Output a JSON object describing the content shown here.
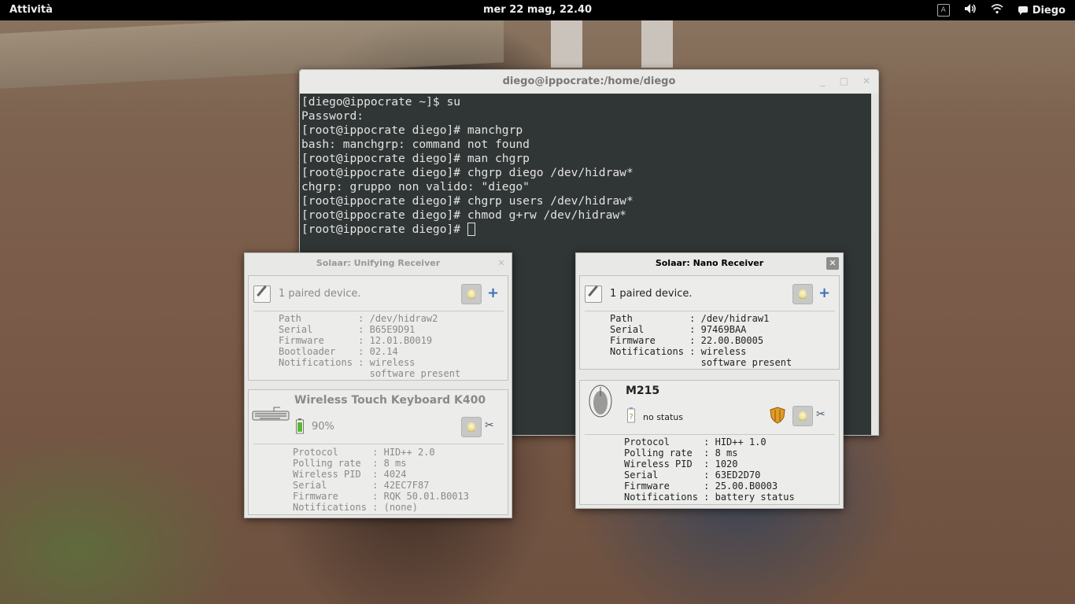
{
  "topbar": {
    "activities": "Attività",
    "clock": "mer 22 mag, 22.40",
    "user": "Diego",
    "icons": [
      "keyboard-layout-icon",
      "volume-icon",
      "wifi-icon",
      "chat-icon"
    ]
  },
  "terminal": {
    "title": "diego@ippocrate:/home/diego",
    "lines": [
      "[diego@ippocrate ~]$ su",
      "Password:",
      "[root@ippocrate diego]# manchgrp",
      "bash: manchgrp: command not found",
      "[root@ippocrate diego]# man chgrp",
      "[root@ippocrate diego]# chgrp diego /dev/hidraw*",
      "chgrp: gruppo non valido: \"diego\"",
      "[root@ippocrate diego]# chgrp users /dev/hidraw*",
      "[root@ippocrate diego]# chmod g+rw /dev/hidraw*",
      "[root@ippocrate diego]# "
    ]
  },
  "unifying": {
    "title": "Solaar: Unifying Receiver",
    "paired": "1 paired device.",
    "receiver_info": "Path          : /dev/hidraw2\nSerial        : B65E9D91\nFirmware      : 12.01.B0019\nBootloader    : 02.14\nNotifications : wireless\n                software present",
    "device": {
      "name": "Wireless Touch Keyboard K400",
      "battery": "90%",
      "info": "Protocol      : HID++ 2.0\nPolling rate  : 8 ms\nWireless PID  : 4024\nSerial        : 42EC7F87\nFirmware      : RQK 50.01.B0013\nNotifications : (none)"
    }
  },
  "nano": {
    "title": "Solaar: Nano Receiver",
    "paired": "1 paired device.",
    "receiver_info": "Path          : /dev/hidraw1\nSerial        : 97469BAA\nFirmware      : 22.00.B0005\nNotifications : wireless\n                software present",
    "device": {
      "name": "M215",
      "status": "no status",
      "info": "Protocol      : HID++ 1.0\nPolling rate  : 8 ms\nWireless PID  : 1020\nSerial        : 63ED2D70\nFirmware      : 25.00.B0003\nNotifications : battery status"
    }
  },
  "colors": {
    "terminal_bg": "#303635",
    "topbar_bg": "#000000",
    "accent": "#3b6dbe"
  }
}
